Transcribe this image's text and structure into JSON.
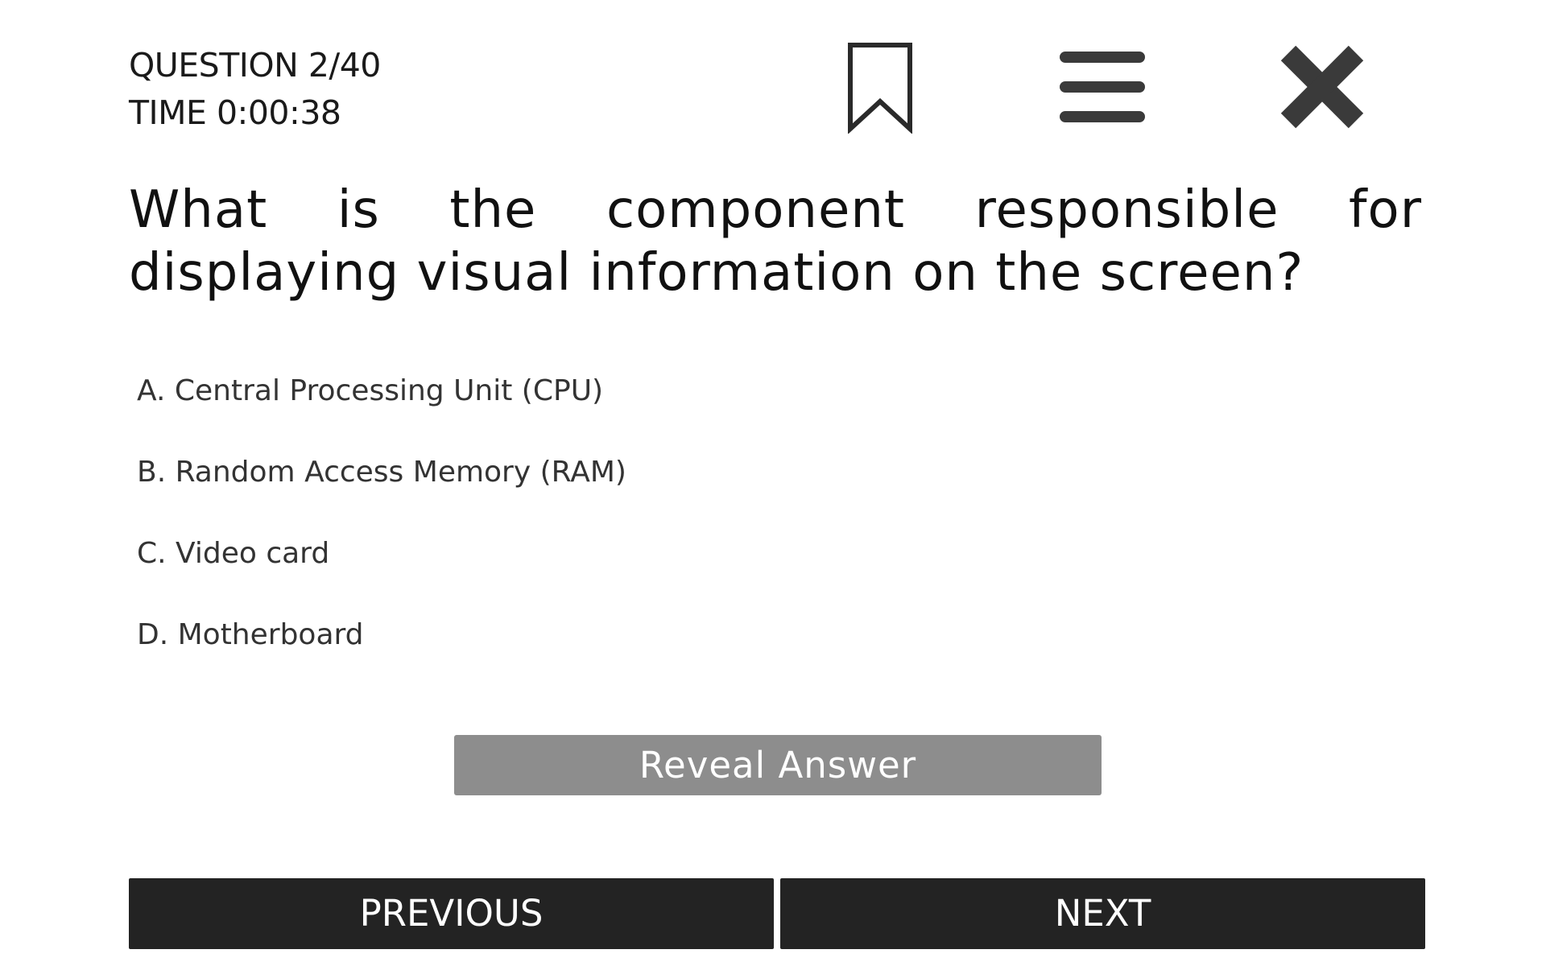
{
  "status": {
    "question_counter": "QUESTION 2/40",
    "timer": "TIME 0:00:38"
  },
  "toolbar": {
    "bookmark_icon": "bookmark-icon",
    "menu_icon": "hamburger-menu-icon",
    "close_icon": "close-icon",
    "icon_color": "#2a2a2a"
  },
  "question": {
    "text": "What is the component responsible for displaying visual information on the screen?"
  },
  "options": [
    {
      "label": "A. Central Processing Unit (CPU)"
    },
    {
      "label": "B. Random Access Memory (RAM)"
    },
    {
      "label": "C. Video card"
    },
    {
      "label": "D. Motherboard"
    }
  ],
  "reveal": {
    "label": "Reveal Answer",
    "color": "#8d8d8d"
  },
  "navigation": {
    "previous_label": "PREVIOUS",
    "next_label": "NEXT",
    "color": "#232323"
  }
}
